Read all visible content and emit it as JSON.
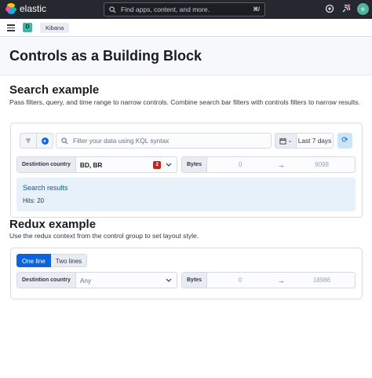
{
  "topbar": {
    "brand": "elastic",
    "search_placeholder": "Find apps, content, and more.",
    "search_shortcut": "⌘/",
    "avatar_initial": "e"
  },
  "subbar": {
    "space_initial": "D",
    "breadcrumb": "Kibana"
  },
  "page": {
    "title": "Controls as a Building Block"
  },
  "search_example": {
    "heading": "Search example",
    "description": "Pass filters, query, and time range to narrow controls. Combine search bar filters with controls filters to narrow results.",
    "query_placeholder": "Filter your data using KQL syntax",
    "date_label": "Last 7 days",
    "controls": {
      "country": {
        "label": "Destintion country",
        "value": "BD, BR",
        "count": "2"
      },
      "bytes": {
        "label": "Bytes",
        "min": "0",
        "max": "9098"
      }
    },
    "results": {
      "title": "Search results",
      "hits": "Hits: 20"
    }
  },
  "redux_example": {
    "heading": "Redux example",
    "description": "Use the redux context from the control group to set layout style.",
    "layout_options": [
      "One line",
      "Two lines"
    ],
    "selected_layout": "One line",
    "controls": {
      "country": {
        "label": "Destintion country",
        "value": "Any"
      },
      "bytes": {
        "label": "Bytes",
        "min": "0",
        "max": "18986"
      }
    }
  },
  "colors": {
    "topbar_bg": "#25282f",
    "accent": "#0b64dd",
    "badge_red": "#bd271e",
    "results_bg": "#e6f1fa"
  }
}
